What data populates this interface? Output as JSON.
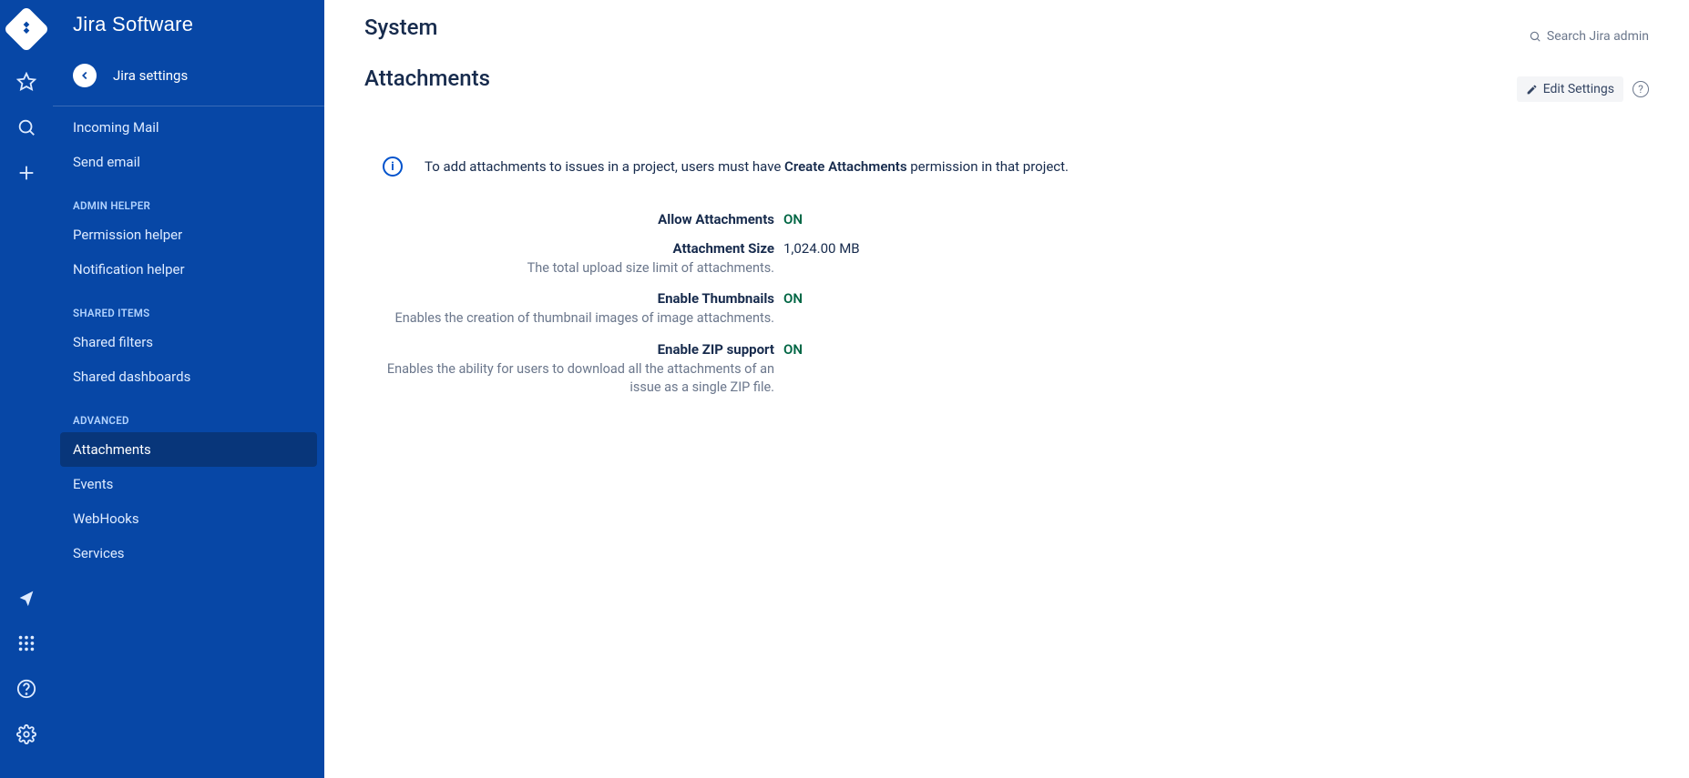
{
  "app_name": "Jira Software",
  "back_label": "Jira settings",
  "sections": {
    "mail": {
      "items": [
        "Incoming Mail",
        "Send email"
      ]
    },
    "admin_helper": {
      "heading": "ADMIN HELPER",
      "items": [
        "Permission helper",
        "Notification helper"
      ]
    },
    "shared_items": {
      "heading": "SHARED ITEMS",
      "items": [
        "Shared filters",
        "Shared dashboards"
      ]
    },
    "advanced": {
      "heading": "ADVANCED",
      "items": [
        "Attachments",
        "Events",
        "WebHooks",
        "Services"
      ]
    }
  },
  "page": {
    "breadcrumb_title": "System",
    "section_title": "Attachments",
    "search_placeholder": "Search Jira admin",
    "edit_button": "Edit Settings"
  },
  "info_message": {
    "prefix": "To add attachments to issues in a project, users must have ",
    "bold": "Create Attachments",
    "suffix": " permission in that project."
  },
  "settings": {
    "allow_attachments": {
      "label": "Allow Attachments",
      "value": "ON"
    },
    "attachment_size": {
      "label": "Attachment Size",
      "value": "1,024.00 MB",
      "desc": "The total upload size limit of attachments."
    },
    "enable_thumbnails": {
      "label": "Enable Thumbnails",
      "value": "ON",
      "desc": "Enables the creation of thumbnail images of image attachments."
    },
    "enable_zip": {
      "label": "Enable ZIP support",
      "value": "ON",
      "desc": "Enables the ability for users to download all the attachments of an issue as a single ZIP file."
    }
  }
}
